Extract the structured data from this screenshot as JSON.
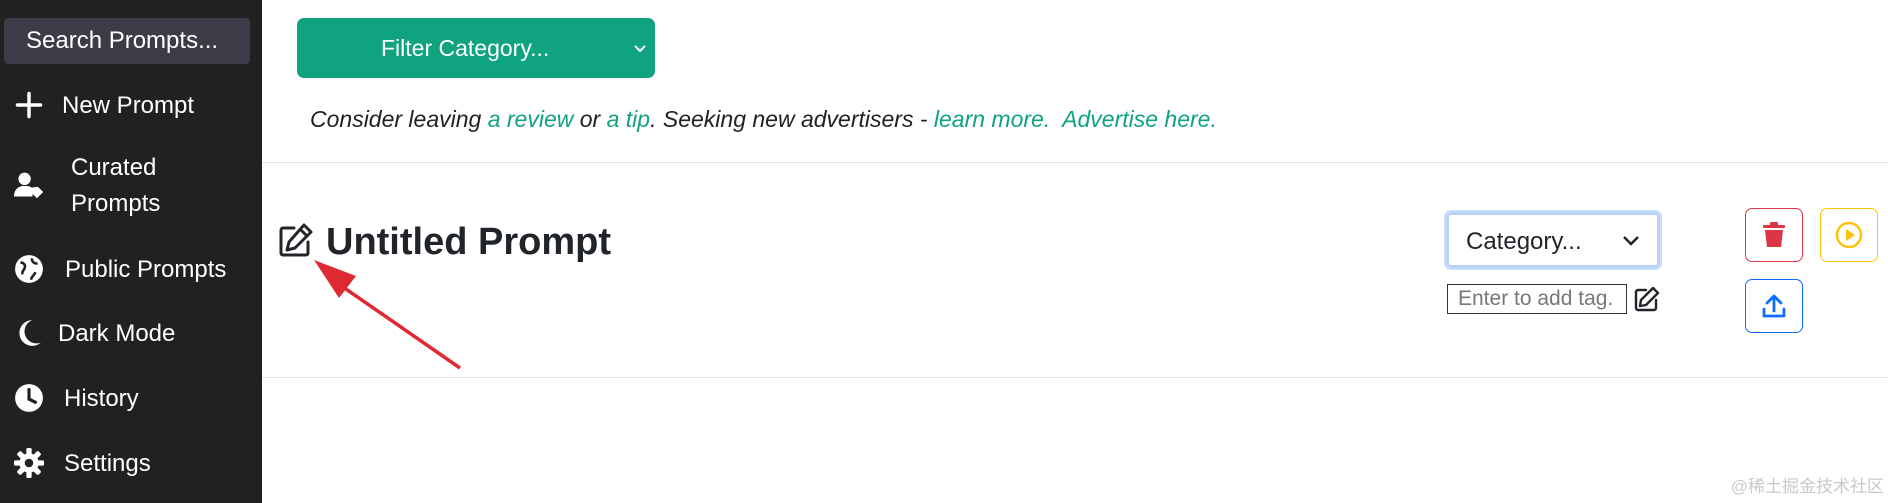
{
  "sidebar": {
    "search_label": "Search Prompts...",
    "items": [
      {
        "label": "New Prompt",
        "icon": "plus-icon"
      },
      {
        "label": "Curated Prompts",
        "icon": "user-tag-icon"
      },
      {
        "label": "Public Prompts",
        "icon": "globe-icon"
      },
      {
        "label": "Dark Mode",
        "icon": "moon-icon"
      },
      {
        "label": "History",
        "icon": "clock-icon"
      },
      {
        "label": "Settings",
        "icon": "gear-icon"
      }
    ]
  },
  "filter": {
    "label": "Filter Category..."
  },
  "notice": {
    "part1": "Consider leaving ",
    "link_review": "a review",
    "part2": " or ",
    "link_tip": "a tip",
    "part3": ". Seeking new advertisers - ",
    "link_learn": "learn more.",
    "link_advertise": "Advertise here."
  },
  "prompt": {
    "title": "Untitled Prompt",
    "category_label": "Category...",
    "tag_placeholder": "Enter to add tag."
  },
  "colors": {
    "sidebar_bg": "#202123",
    "accent": "#10a37f",
    "delete": "#dc3545",
    "run": "#ffc107",
    "share": "#0d6efd",
    "annotation_arrow": "#e02a33"
  },
  "watermark": "@稀土掘金技术社区"
}
